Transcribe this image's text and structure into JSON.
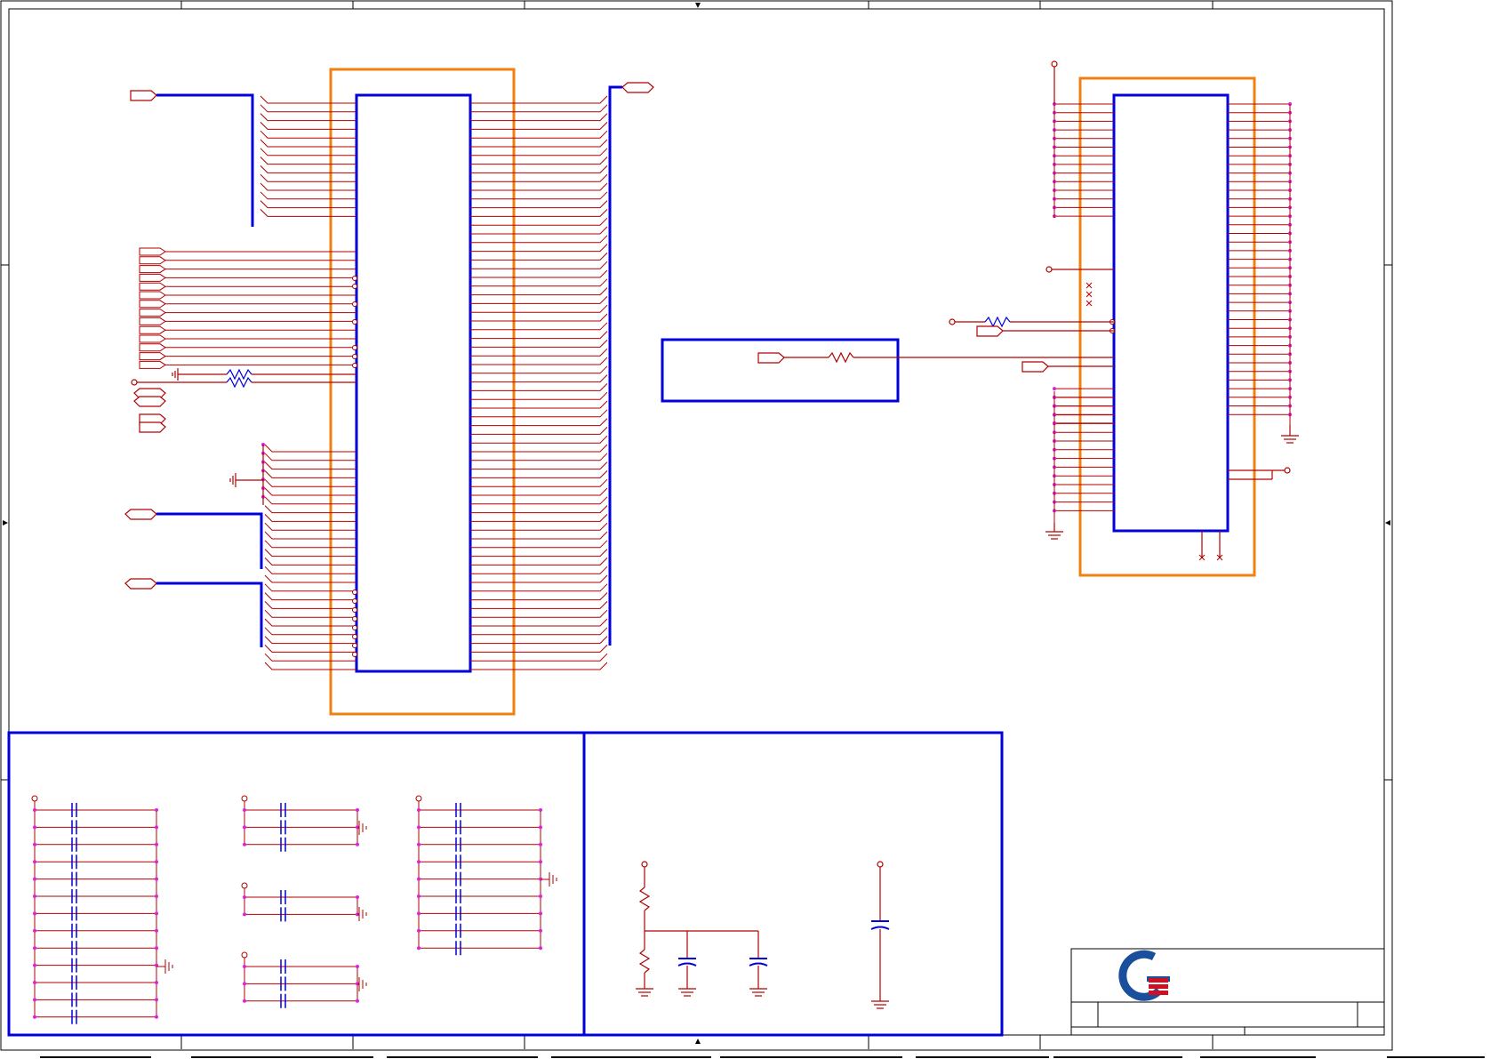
{
  "colors": {
    "wire": "#b00000",
    "bus": "#0000dd",
    "chip_outline": "#0000dd",
    "highlight_box": "#f08010",
    "pin_dot": "#e020e0",
    "frame": "#000000",
    "logo_blue": "#1a4f9c",
    "logo_red": "#d01020"
  },
  "icons": {
    "ground": "ground-symbol-icon",
    "power": "power-rail-icon",
    "capacitor": "capacitor-icon",
    "resistor": "resistor-icon",
    "logo": "company-logo-icon"
  },
  "schematic": {
    "left_connector_rows": 66,
    "right_connector_rows": 38,
    "decoupling_groups": 5
  }
}
